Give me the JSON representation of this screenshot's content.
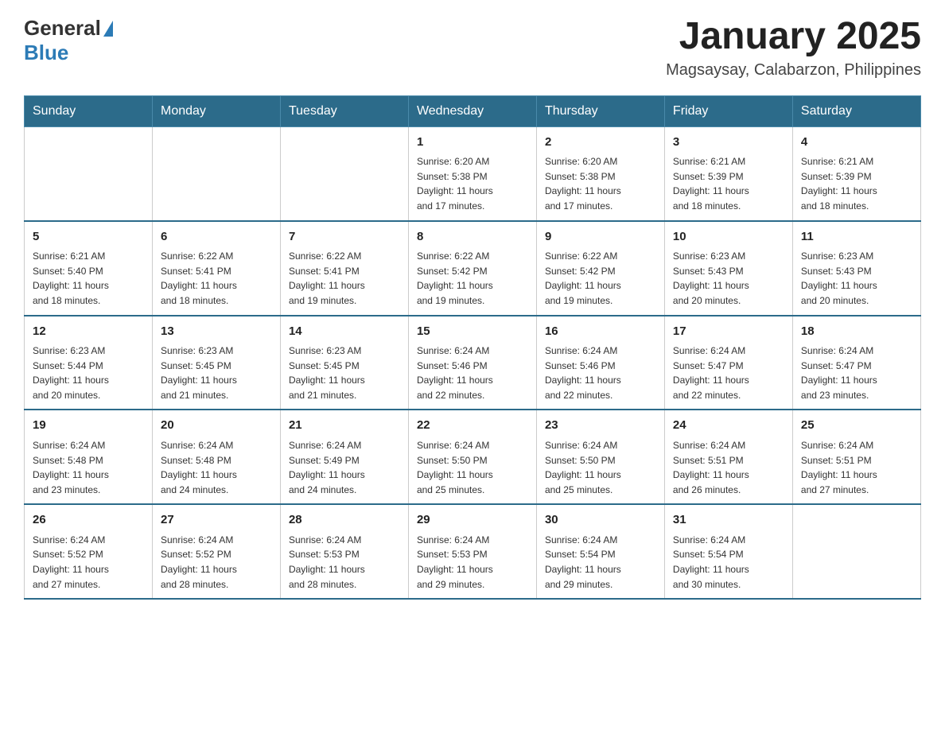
{
  "header": {
    "logo_general": "General",
    "logo_blue": "Blue",
    "title": "January 2025",
    "subtitle": "Magsaysay, Calabarzon, Philippines"
  },
  "calendar": {
    "days_of_week": [
      "Sunday",
      "Monday",
      "Tuesday",
      "Wednesday",
      "Thursday",
      "Friday",
      "Saturday"
    ],
    "weeks": [
      [
        {
          "day": "",
          "info": ""
        },
        {
          "day": "",
          "info": ""
        },
        {
          "day": "",
          "info": ""
        },
        {
          "day": "1",
          "info": "Sunrise: 6:20 AM\nSunset: 5:38 PM\nDaylight: 11 hours\nand 17 minutes."
        },
        {
          "day": "2",
          "info": "Sunrise: 6:20 AM\nSunset: 5:38 PM\nDaylight: 11 hours\nand 17 minutes."
        },
        {
          "day": "3",
          "info": "Sunrise: 6:21 AM\nSunset: 5:39 PM\nDaylight: 11 hours\nand 18 minutes."
        },
        {
          "day": "4",
          "info": "Sunrise: 6:21 AM\nSunset: 5:39 PM\nDaylight: 11 hours\nand 18 minutes."
        }
      ],
      [
        {
          "day": "5",
          "info": "Sunrise: 6:21 AM\nSunset: 5:40 PM\nDaylight: 11 hours\nand 18 minutes."
        },
        {
          "day": "6",
          "info": "Sunrise: 6:22 AM\nSunset: 5:41 PM\nDaylight: 11 hours\nand 18 minutes."
        },
        {
          "day": "7",
          "info": "Sunrise: 6:22 AM\nSunset: 5:41 PM\nDaylight: 11 hours\nand 19 minutes."
        },
        {
          "day": "8",
          "info": "Sunrise: 6:22 AM\nSunset: 5:42 PM\nDaylight: 11 hours\nand 19 minutes."
        },
        {
          "day": "9",
          "info": "Sunrise: 6:22 AM\nSunset: 5:42 PM\nDaylight: 11 hours\nand 19 minutes."
        },
        {
          "day": "10",
          "info": "Sunrise: 6:23 AM\nSunset: 5:43 PM\nDaylight: 11 hours\nand 20 minutes."
        },
        {
          "day": "11",
          "info": "Sunrise: 6:23 AM\nSunset: 5:43 PM\nDaylight: 11 hours\nand 20 minutes."
        }
      ],
      [
        {
          "day": "12",
          "info": "Sunrise: 6:23 AM\nSunset: 5:44 PM\nDaylight: 11 hours\nand 20 minutes."
        },
        {
          "day": "13",
          "info": "Sunrise: 6:23 AM\nSunset: 5:45 PM\nDaylight: 11 hours\nand 21 minutes."
        },
        {
          "day": "14",
          "info": "Sunrise: 6:23 AM\nSunset: 5:45 PM\nDaylight: 11 hours\nand 21 minutes."
        },
        {
          "day": "15",
          "info": "Sunrise: 6:24 AM\nSunset: 5:46 PM\nDaylight: 11 hours\nand 22 minutes."
        },
        {
          "day": "16",
          "info": "Sunrise: 6:24 AM\nSunset: 5:46 PM\nDaylight: 11 hours\nand 22 minutes."
        },
        {
          "day": "17",
          "info": "Sunrise: 6:24 AM\nSunset: 5:47 PM\nDaylight: 11 hours\nand 22 minutes."
        },
        {
          "day": "18",
          "info": "Sunrise: 6:24 AM\nSunset: 5:47 PM\nDaylight: 11 hours\nand 23 minutes."
        }
      ],
      [
        {
          "day": "19",
          "info": "Sunrise: 6:24 AM\nSunset: 5:48 PM\nDaylight: 11 hours\nand 23 minutes."
        },
        {
          "day": "20",
          "info": "Sunrise: 6:24 AM\nSunset: 5:48 PM\nDaylight: 11 hours\nand 24 minutes."
        },
        {
          "day": "21",
          "info": "Sunrise: 6:24 AM\nSunset: 5:49 PM\nDaylight: 11 hours\nand 24 minutes."
        },
        {
          "day": "22",
          "info": "Sunrise: 6:24 AM\nSunset: 5:50 PM\nDaylight: 11 hours\nand 25 minutes."
        },
        {
          "day": "23",
          "info": "Sunrise: 6:24 AM\nSunset: 5:50 PM\nDaylight: 11 hours\nand 25 minutes."
        },
        {
          "day": "24",
          "info": "Sunrise: 6:24 AM\nSunset: 5:51 PM\nDaylight: 11 hours\nand 26 minutes."
        },
        {
          "day": "25",
          "info": "Sunrise: 6:24 AM\nSunset: 5:51 PM\nDaylight: 11 hours\nand 27 minutes."
        }
      ],
      [
        {
          "day": "26",
          "info": "Sunrise: 6:24 AM\nSunset: 5:52 PM\nDaylight: 11 hours\nand 27 minutes."
        },
        {
          "day": "27",
          "info": "Sunrise: 6:24 AM\nSunset: 5:52 PM\nDaylight: 11 hours\nand 28 minutes."
        },
        {
          "day": "28",
          "info": "Sunrise: 6:24 AM\nSunset: 5:53 PM\nDaylight: 11 hours\nand 28 minutes."
        },
        {
          "day": "29",
          "info": "Sunrise: 6:24 AM\nSunset: 5:53 PM\nDaylight: 11 hours\nand 29 minutes."
        },
        {
          "day": "30",
          "info": "Sunrise: 6:24 AM\nSunset: 5:54 PM\nDaylight: 11 hours\nand 29 minutes."
        },
        {
          "day": "31",
          "info": "Sunrise: 6:24 AM\nSunset: 5:54 PM\nDaylight: 11 hours\nand 30 minutes."
        },
        {
          "day": "",
          "info": ""
        }
      ]
    ]
  }
}
